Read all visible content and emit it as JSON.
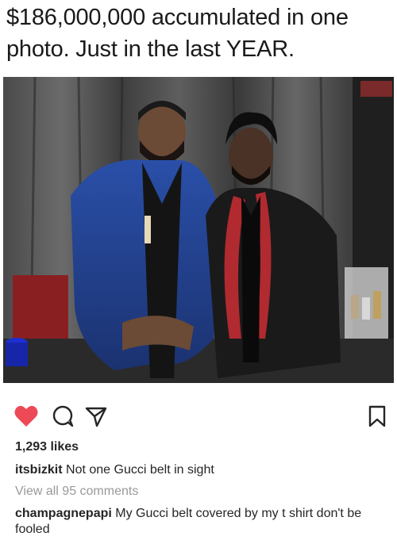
{
  "headline": "$186,000,000 accumulated in one photo. Just in the last YEAR.",
  "photo": {
    "alt": "Two men posing together backstage in front of a dark curtain",
    "icons": [
      "person-left",
      "person-right",
      "curtain",
      "cup",
      "box"
    ]
  },
  "actions": {
    "like_icon": "heart-icon",
    "comment_icon": "comment-icon",
    "share_icon": "share-icon",
    "save_icon": "bookmark-icon",
    "liked": true,
    "like_color": "#ed4956"
  },
  "likes": "1,293 likes",
  "caption": {
    "username": "itsbizkit",
    "text": "Not one Gucci belt in sight"
  },
  "view_all": "View all 95 comments",
  "comment": {
    "username": "champagnepapi",
    "text": "My Gucci belt covered by my t shirt don't be fooled"
  }
}
